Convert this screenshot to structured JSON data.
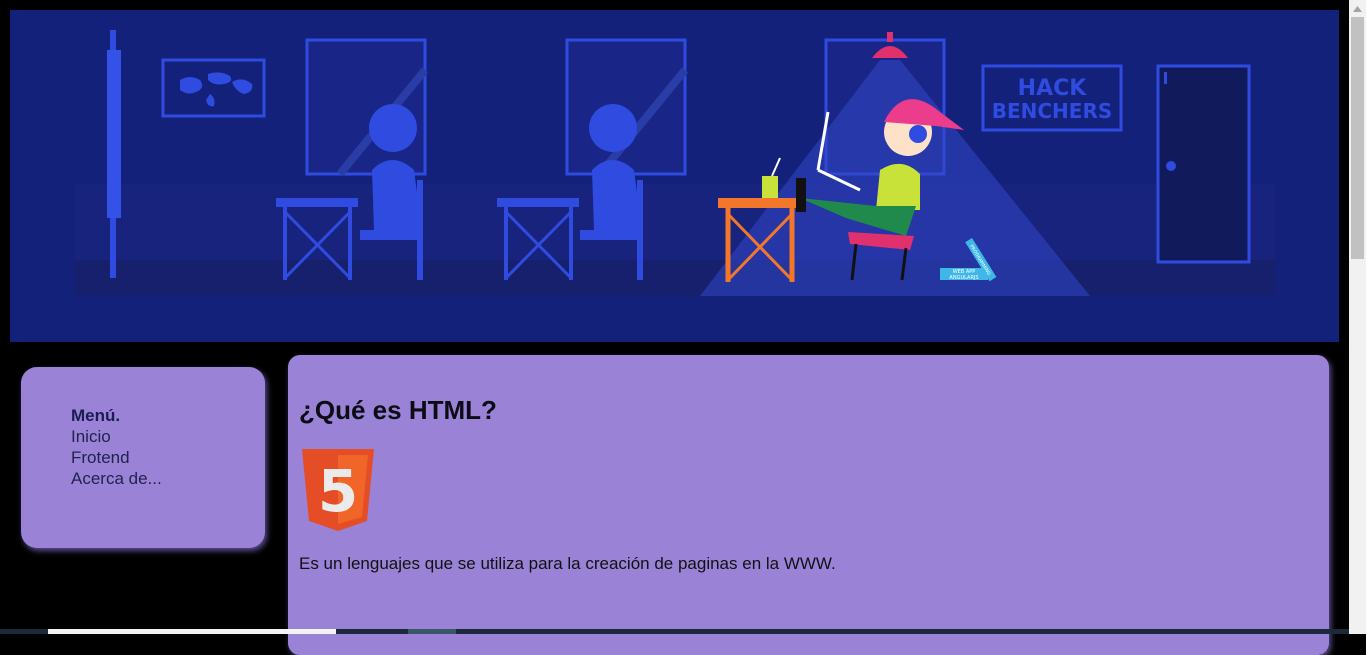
{
  "banner": {
    "sign_line1": "HACK",
    "sign_line2": "BENCHERS",
    "laptop_label_line1": "WEB APP",
    "laptop_label_line2": "ANGULARJS",
    "book_label": "PROGRAMMING"
  },
  "menu": {
    "title": "Menú.",
    "items": [
      "Inicio",
      "Frotend",
      "Acerca de..."
    ]
  },
  "content": {
    "heading": "¿Qué es HTML?",
    "logo_number": "5",
    "paragraph": "Es un lenguajes que se utiliza para la creación de paginas en la WWW."
  },
  "colors": {
    "banner_bg": "#13217a",
    "panel_bg": "#9a82d7",
    "page_bg": "#000000",
    "html5_orange": "#e44d26"
  }
}
